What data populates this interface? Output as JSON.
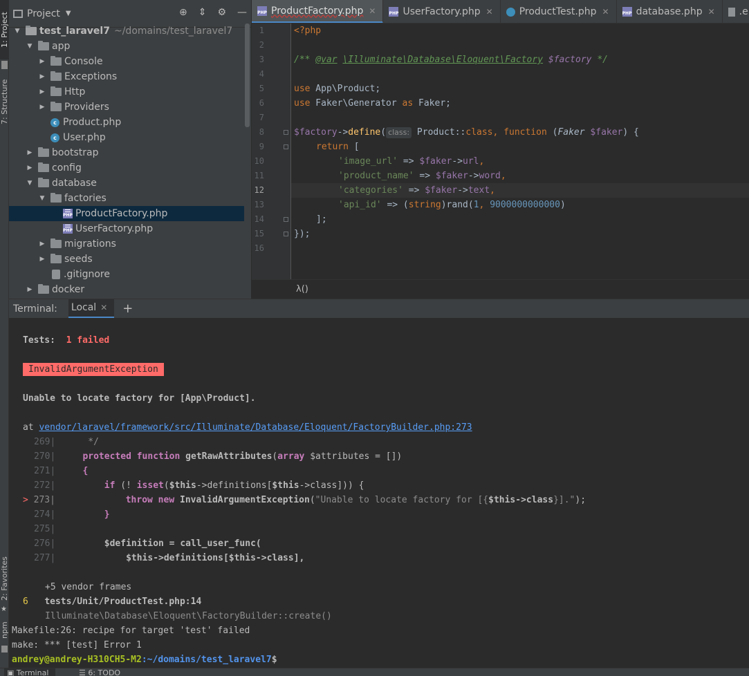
{
  "side_tabs": {
    "project": "1: Project",
    "structure": "7: Structure",
    "favorites": "2: Favorites",
    "npm": "npm"
  },
  "project_panel": {
    "title": "Project",
    "tree": [
      {
        "label": "test_laravel7",
        "suffix": "~/domains/test_laravel7",
        "depth": 0,
        "open": true,
        "kind": "root"
      },
      {
        "label": "app",
        "depth": 1,
        "open": true,
        "kind": "folder"
      },
      {
        "label": "Console",
        "depth": 2,
        "open": false,
        "kind": "folder"
      },
      {
        "label": "Exceptions",
        "depth": 2,
        "open": false,
        "kind": "folder"
      },
      {
        "label": "Http",
        "depth": 2,
        "open": false,
        "kind": "folder"
      },
      {
        "label": "Providers",
        "depth": 2,
        "open": false,
        "kind": "folder"
      },
      {
        "label": "Product.php",
        "depth": 2,
        "kind": "class"
      },
      {
        "label": "User.php",
        "depth": 2,
        "kind": "class"
      },
      {
        "label": "bootstrap",
        "depth": 1,
        "open": false,
        "kind": "folder"
      },
      {
        "label": "config",
        "depth": 1,
        "open": false,
        "kind": "folder"
      },
      {
        "label": "database",
        "depth": 1,
        "open": true,
        "kind": "folder"
      },
      {
        "label": "factories",
        "depth": 2,
        "open": true,
        "kind": "folder"
      },
      {
        "label": "ProductFactory.php",
        "depth": 3,
        "kind": "php",
        "selected": true
      },
      {
        "label": "UserFactory.php",
        "depth": 3,
        "kind": "php"
      },
      {
        "label": "migrations",
        "depth": 2,
        "open": false,
        "kind": "folder"
      },
      {
        "label": "seeds",
        "depth": 2,
        "open": false,
        "kind": "folder"
      },
      {
        "label": ".gitignore",
        "depth": 2,
        "kind": "git"
      },
      {
        "label": "docker",
        "depth": 1,
        "open": false,
        "kind": "folder"
      }
    ]
  },
  "editor": {
    "tabs": [
      {
        "label": "ProductFactory.php",
        "kind": "php",
        "active": true
      },
      {
        "label": "UserFactory.php",
        "kind": "php"
      },
      {
        "label": "ProductTest.php",
        "kind": "class"
      },
      {
        "label": "database.php",
        "kind": "php"
      },
      {
        "label": ".env",
        "kind": "env"
      }
    ],
    "line_numbers": [
      "1",
      "2",
      "3",
      "4",
      "5",
      "6",
      "7",
      "8",
      "9",
      "10",
      "11",
      "12",
      "13",
      "14",
      "15",
      "16"
    ],
    "current_line": "12",
    "code": {
      "l1": "<?php",
      "l3_open": "/** ",
      "l3_tag": "@var",
      "l3_type": "\\Illuminate\\Database\\Eloquent\\Factory",
      "l3_var": "$factory",
      "l3_close": " */",
      "l5_kw": "use",
      "l5_rest": " App\\Product;",
      "l6_kw": "use",
      "l6_mid": " Faker\\Generator ",
      "l6_as": "as",
      "l6_end": " Faker;",
      "l8_var": "$factory",
      "l8_arrow": "->",
      "l8_fn": "define",
      "l8_paren": "(",
      "l8_hint": "class:",
      "l8_cls": " Product::",
      "l8_class": "class",
      "l8_comma": ", ",
      "l8_function": "function",
      "l8_args_open": " (",
      "l8_type": "Faker",
      "l8_argvar": " $faker",
      "l8_end": ") {",
      "l9_kw": "return",
      "l9_rest": " [",
      "l10_key": "'image_url'",
      "l10_op": " => ",
      "l10_var": "$faker",
      "l10_arrow": "->",
      "l10_prop": "url",
      "l10_end": ",",
      "l11_key": "'product_name'",
      "l11_op": " => ",
      "l11_var": "$faker",
      "l11_arrow": "->",
      "l11_prop": "word",
      "l11_end": ",",
      "l12_key": "'categories'",
      "l12_op": " => ",
      "l12_var": "$faker",
      "l12_arrow": "->",
      "l12_prop": "text",
      "l12_end": ",",
      "l13_key": "'api_id'",
      "l13_op": " => (",
      "l13_cast": "string",
      "l13_mid": ")rand(",
      "l13_n1": "1",
      "l13_comma": ", ",
      "l13_n2": "9000000000000",
      "l13_end": ")",
      "l14": "];",
      "l15": "});"
    },
    "breadcrumb": "λ()"
  },
  "terminal": {
    "label": "Terminal:",
    "tab": "Local",
    "tests_label": "Tests:",
    "tests_value": "1 failed",
    "exception": "InvalidArgumentException",
    "message": "Unable to locate factory for [App\\Product].",
    "at": "at ",
    "at_link": "vendor/laravel/framework/src/Illuminate/Database/Eloquent/FactoryBuilder.php:273",
    "code_lines": {
      "n269": "269|",
      "c269": "*/",
      "n270": "270|",
      "c270_kw": "protected function ",
      "c270_fn": "getRawAttributes",
      "c270_open": "(",
      "c270_type": "array",
      "c270_rest": " $attributes = [])",
      "n271": "271|",
      "c271": "{",
      "n272": "272|",
      "c272_kw": "if",
      "c272_mid": " (! ",
      "c272_fn": "isset",
      "c272_open": "(",
      "c272_this": "$this",
      "c272_b": "->definitions[",
      "c272_this2": "$this",
      "c272_rest": "->class])) {",
      "marker": ">",
      "n273": "273|",
      "c273_kw": "throw new ",
      "c273_cls": "InvalidArgumentException",
      "c273_open": "(",
      "c273_str": "\"Unable to locate factory for [{",
      "c273_this": "$this",
      "c273_mid": "->class",
      "c273_strend": "}].\"",
      "c273_end": ");",
      "n274": "274|",
      "c274": "}",
      "n275": "275|",
      "n276": "276|",
      "c276_var": "$definition",
      "c276_rest": " = call_user_func(",
      "n277": "277|",
      "c277_this": "$this",
      "c277_b": "->definitions[",
      "c277_this2": "$this",
      "c277_rest": "->class],"
    },
    "vendor_frames": "+5 vendor frames",
    "frame_num": "6",
    "frame_file": "tests/Unit/ProductTest.php:14",
    "frame_call": "Illuminate\\Database\\Eloquent\\FactoryBuilder::create()",
    "make1": "Makefile:26: recipe for target 'test' failed",
    "make2": "make: *** [test] Error 1",
    "prompt_user": "andrey@andrey-H310CH5-M2",
    "prompt_path": ":~/domains/test_laravel7",
    "prompt_end": "$"
  },
  "status_bar": {
    "terminal": "Terminal",
    "todo": "6: TODO"
  },
  "colors": {
    "accent": "#4a88c7",
    "error": "#ff6b68",
    "selection": "#0d293e"
  }
}
